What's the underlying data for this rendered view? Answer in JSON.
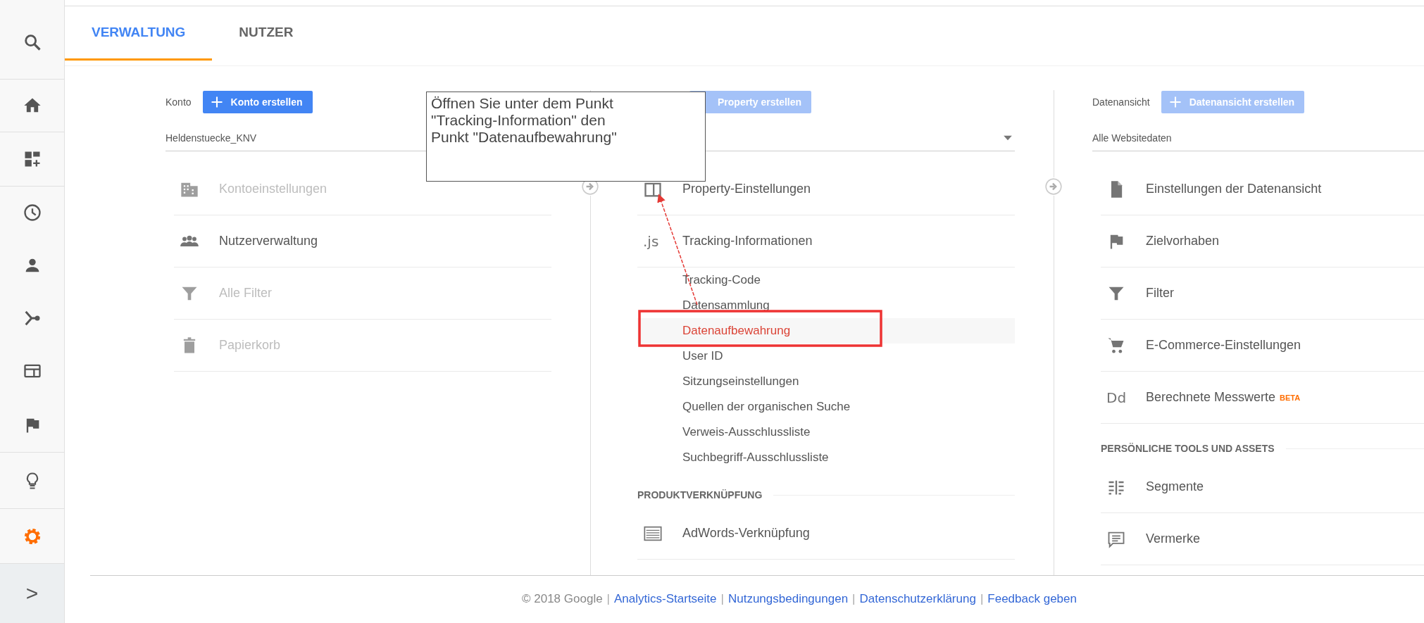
{
  "sidebar": {
    "items": [
      {
        "selected": false
      },
      {
        "selected": false
      },
      {
        "selected": false
      },
      {
        "selected": false
      },
      {
        "selected": false
      },
      {
        "selected": false
      },
      {
        "selected": false
      },
      {
        "selected": false
      },
      {
        "selected": false
      },
      {
        "selected": true
      }
    ],
    "expand_label": ">"
  },
  "tabs": [
    {
      "label": "VERWALTUNG",
      "selected": true
    },
    {
      "label": "NUTZER",
      "selected": false
    }
  ],
  "columns": [
    {
      "label": "Konto",
      "button": {
        "label": "Konto erstellen",
        "disabled": false,
        "show_plus": true
      },
      "selector": {
        "value": "Heldenstuecke_KNV"
      },
      "connector": false,
      "items": [
        {
          "kind": "entry",
          "label": "Kontoeinstellungen",
          "disabled": true
        },
        {
          "kind": "entry",
          "label": "Nutzerverwaltung",
          "disabled": false
        },
        {
          "kind": "entry",
          "label": "Alle Filter",
          "disabled": true
        },
        {
          "kind": "entry",
          "label": "Papierkorb",
          "disabled": true
        }
      ]
    },
    {
      "button": {
        "label": "Property erstellen",
        "disabled": true,
        "show_plus": false
      },
      "selector": {
        "dropdown": true
      },
      "connector": true,
      "items": [
        {
          "kind": "entry",
          "label": "Property-Einstellungen",
          "disabled": false
        },
        {
          "kind": "entry",
          "label": "Tracking-Informationen",
          "icon_text": ".js",
          "disabled": false
        },
        {
          "kind": "sub",
          "label": "Tracking-Code",
          "selected": false
        },
        {
          "kind": "sub",
          "label": "Datensammlung",
          "selected": false
        },
        {
          "kind": "sub",
          "label": "Datenaufbewahrung",
          "selected": true
        },
        {
          "kind": "sub",
          "label": "User ID",
          "selected": false
        },
        {
          "kind": "sub",
          "label": "Sitzungseinstellungen",
          "selected": false
        },
        {
          "kind": "sub",
          "label": "Quellen der organischen Suche",
          "selected": false
        },
        {
          "kind": "sub",
          "label": "Verweis-Ausschlussliste",
          "selected": false
        },
        {
          "kind": "sub",
          "label": "Suchbegriff-Ausschlussliste",
          "selected": false
        },
        {
          "kind": "section",
          "label": "PRODUKTVERKNÜPFUNG"
        },
        {
          "kind": "entry",
          "label": "AdWords-Verknüpfung",
          "disabled": false
        }
      ]
    },
    {
      "label": "Datenansicht",
      "button": {
        "label": "Datenansicht erstellen",
        "disabled": true,
        "show_plus": true
      },
      "selector": {
        "value": "Alle Websitedaten"
      },
      "connector": true,
      "items": [
        {
          "kind": "entry",
          "label": "Einstellungen der Datenansicht",
          "disabled": false
        },
        {
          "kind": "entry",
          "label": "Zielvorhaben",
          "disabled": false
        },
        {
          "kind": "entry",
          "label": "Filter",
          "disabled": false
        },
        {
          "kind": "entry",
          "label": "E-Commerce-Einstellungen",
          "disabled": false
        },
        {
          "kind": "entry",
          "label": "Berechnete Messwerte",
          "icon_text": "Dd",
          "badge": "BETA",
          "disabled": false
        },
        {
          "kind": "section",
          "label": "PERSÖNLICHE TOOLS UND ASSETS"
        },
        {
          "kind": "entry",
          "label": "Segmente",
          "disabled": false
        },
        {
          "kind": "entry",
          "label": "Vermerke",
          "disabled": false
        }
      ]
    }
  ],
  "footer": {
    "parts": [
      {
        "kind": "text",
        "text": "© 2018 Google"
      },
      {
        "kind": "sep",
        "text": "|"
      },
      {
        "kind": "link",
        "text": "Analytics-Startseite"
      },
      {
        "kind": "sep",
        "text": "|"
      },
      {
        "kind": "link",
        "text": "Nutzungsbedingungen"
      },
      {
        "kind": "sep",
        "text": "|"
      },
      {
        "kind": "link",
        "text": "Datenschutzerklärung"
      },
      {
        "kind": "sep",
        "text": "|"
      },
      {
        "kind": "link",
        "text": "Feedback geben"
      }
    ]
  },
  "callout": {
    "text": "Öffnen Sie unter dem Punkt \"Tracking-Information\" den Punkt \"Datenaufbewahrung\""
  }
}
